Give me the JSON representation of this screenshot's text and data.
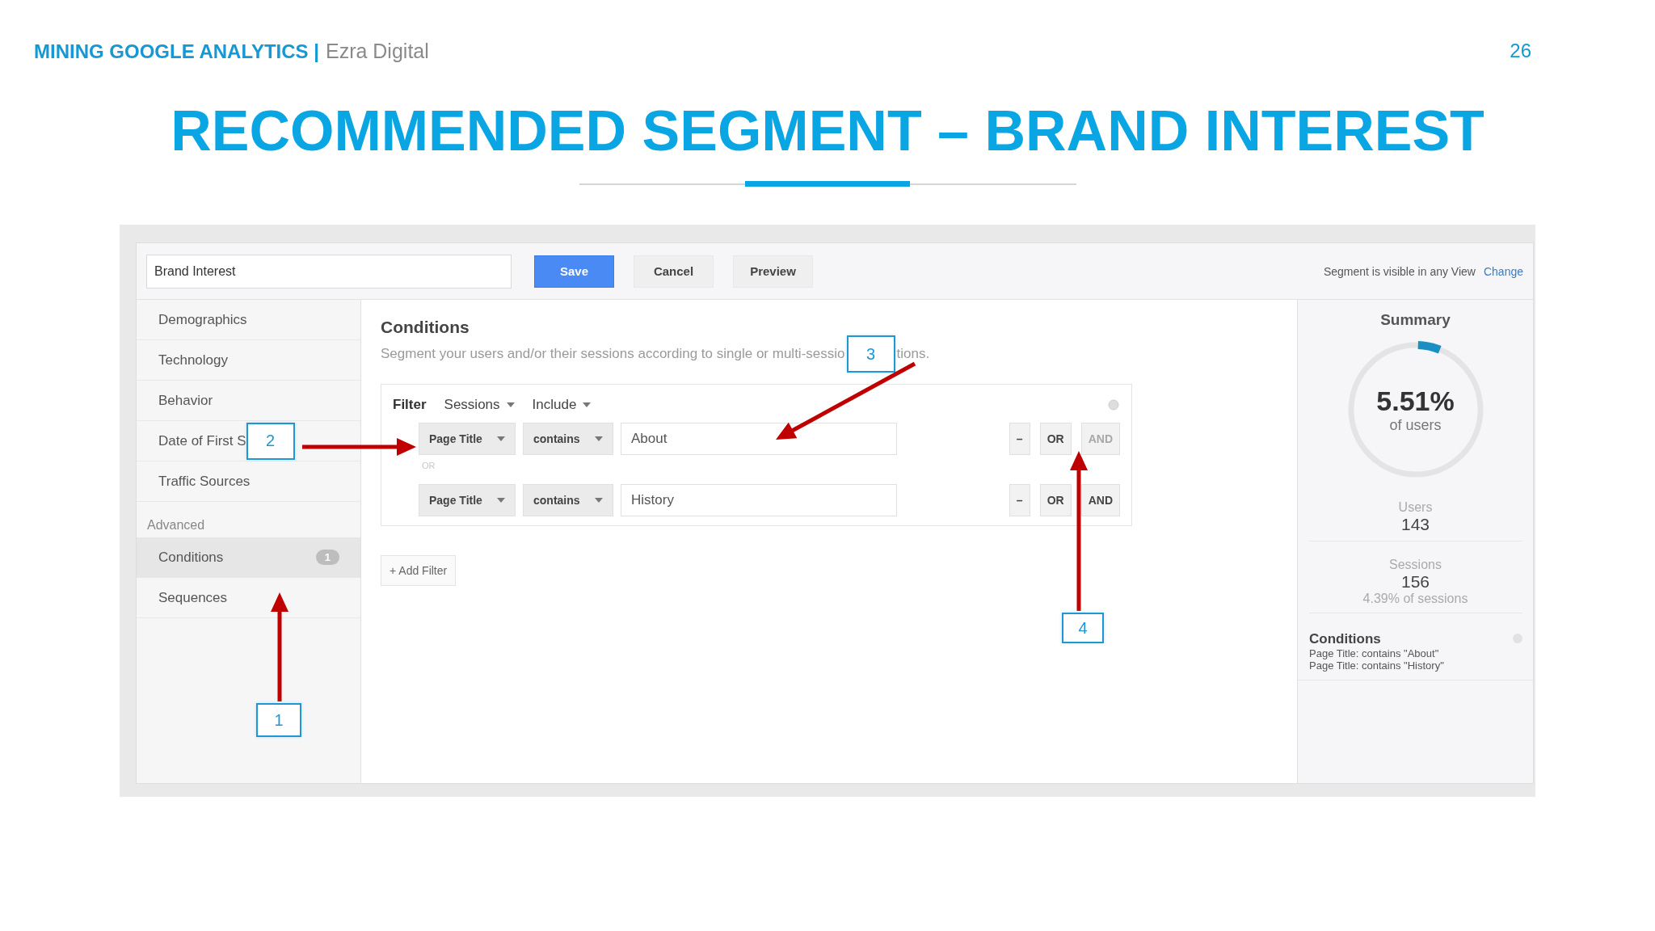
{
  "header": {
    "brand": "MINING GOOGLE ANALYTICS |",
    "company": "Ezra Digital",
    "page_number": "26"
  },
  "title": "RECOMMENDED SEGMENT – BRAND INTEREST",
  "editor": {
    "name_field": {
      "value": "Brand Interest"
    },
    "buttons": [
      {
        "label": "Save",
        "kind": "primary"
      },
      {
        "label": "Cancel",
        "kind": "plain"
      },
      {
        "label": "Preview",
        "kind": "plain"
      }
    ],
    "visibility_note": "Segment is visible in any View",
    "visibility_link": "Change",
    "sidebar": {
      "items": [
        {
          "label": "Demographics",
          "selected": false
        },
        {
          "label": "Technology",
          "selected": false
        },
        {
          "label": "Behavior",
          "selected": false
        },
        {
          "label": "Date of First S",
          "selected": false
        },
        {
          "label": "Traffic Sources",
          "selected": false
        }
      ],
      "section_label": "Advanced",
      "advanced_items": [
        {
          "label": "Conditions",
          "badge": "1",
          "selected": true
        },
        {
          "label": "Sequences",
          "selected": false
        }
      ]
    },
    "main": {
      "heading": "Conditions",
      "description_parts": [
        "Segment your users and/or their sessions according to single or multi-sessio",
        "tions."
      ],
      "filter": {
        "label": "Filter",
        "scope": "Sessions",
        "mode": "Include",
        "connector": "OR",
        "rows": [
          {
            "dimension": "Page Title",
            "operator": "contains",
            "value": "About",
            "remove": "–",
            "toggles": [
              {
                "label": "OR",
                "disabled": false
              },
              {
                "label": "AND",
                "disabled": true
              }
            ]
          },
          {
            "dimension": "Page Title",
            "operator": "contains",
            "value": "History",
            "remove": "–",
            "toggles": [
              {
                "label": "OR",
                "disabled": false
              },
              {
                "label": "AND",
                "disabled": false
              }
            ]
          }
        ]
      },
      "add_filter": "+ Add Filter"
    },
    "summary": {
      "title": "Summary",
      "percent": "5.51%",
      "percent_caption": "of users",
      "level": 0.0551,
      "stats": [
        {
          "label": "Users",
          "value": "143"
        },
        {
          "label": "Sessions",
          "value": "156",
          "note": "4.39% of sessions"
        }
      ],
      "conditions": {
        "title": "Conditions",
        "lines": [
          "Page Title: contains \"About\"",
          "Page Title: contains \"History\""
        ]
      }
    }
  },
  "callouts": [
    {
      "number": "1"
    },
    {
      "number": "2"
    },
    {
      "number": "3"
    },
    {
      "number": "4"
    }
  ]
}
